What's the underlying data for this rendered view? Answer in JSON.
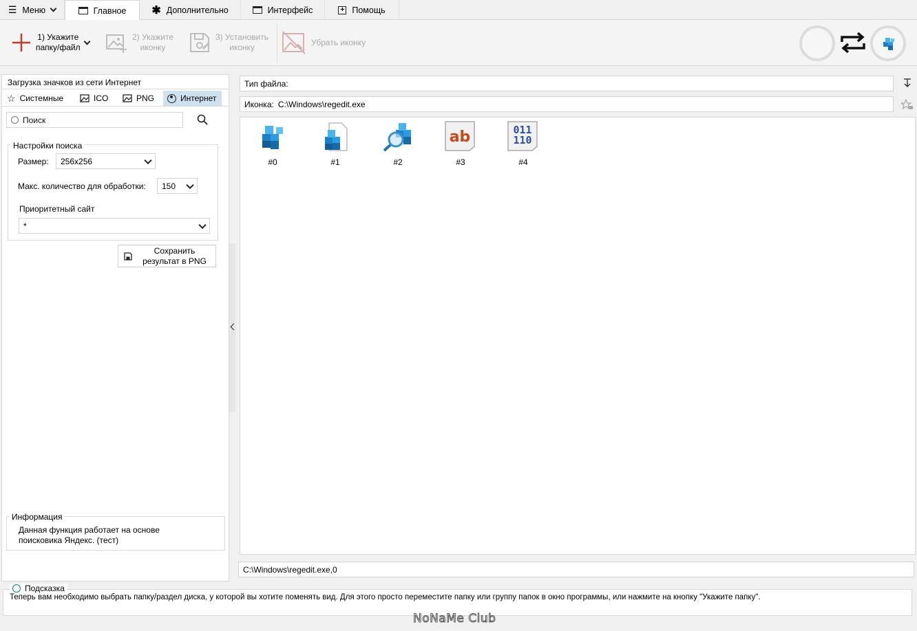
{
  "menubar": {
    "menu_label": "Меню",
    "tabs": [
      {
        "label": "Главное"
      },
      {
        "label": "Дополнительно"
      },
      {
        "label": "Интерфейс"
      },
      {
        "label": "Помощь"
      }
    ]
  },
  "ribbon": {
    "btn1": "1) Укажите\nпапку/файл",
    "btn2": "2) Укажите\nиконку",
    "btn3": "3) Установить\nиконку",
    "btn4": "Убрать иконку"
  },
  "left": {
    "header": "Загрузка значков из сети Интернет",
    "tabs": [
      "Системные",
      "ICO",
      "PNG",
      "Интернет"
    ],
    "search_placeholder": "Поиск",
    "settings_title": "Настройки поиска",
    "size_label": "Размер:",
    "size_value": "256x256",
    "max_label": "Макс. количество для обработки:",
    "max_value": "150",
    "priority_label": "Приоритетный сайт",
    "priority_value": "*",
    "save_button": "Сохранить\nрезультат в PNG",
    "info_title": "Информация",
    "info_text": "Данная функция работает на основе\nпоисковика Яндекс. (тест)"
  },
  "right": {
    "filetype_label": "Тип файла:",
    "icon_label": "Иконка:",
    "icon_path": "C:\\Windows\\regedit.exe",
    "icons": [
      "#0",
      "#1",
      "#2",
      "#3",
      "#4"
    ],
    "icon3_text": "ab",
    "icon4_line1": "011",
    "icon4_line2": "110",
    "status_path": "C:\\Windows\\regedit.exe,0"
  },
  "hint": {
    "title": "Подсказка",
    "text": "Теперь вам необходимо выбрать папку/раздел диска, у которой вы хотите поменять вид. Для этого просто переместите папку или группу папок в окно программы, или нажмите на кнопку \"Укажите папку\"."
  },
  "watermark": "NoNaMe Club"
}
